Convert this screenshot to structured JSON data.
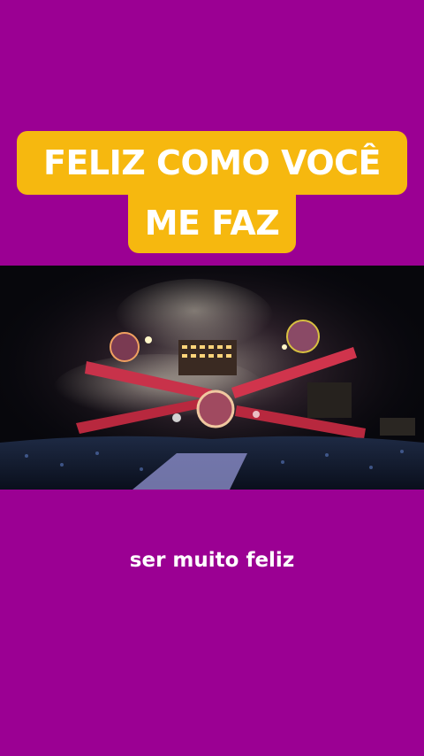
{
  "title": {
    "line1": "FELIZ COMO VOCÊ",
    "line2": "ME FAZ"
  },
  "caption": "ser muito feliz",
  "colors": {
    "background": "#9b0093",
    "title_highlight": "#f6b80f",
    "text": "#ffffff"
  },
  "media": {
    "description_icon": "concert-stage-image"
  }
}
